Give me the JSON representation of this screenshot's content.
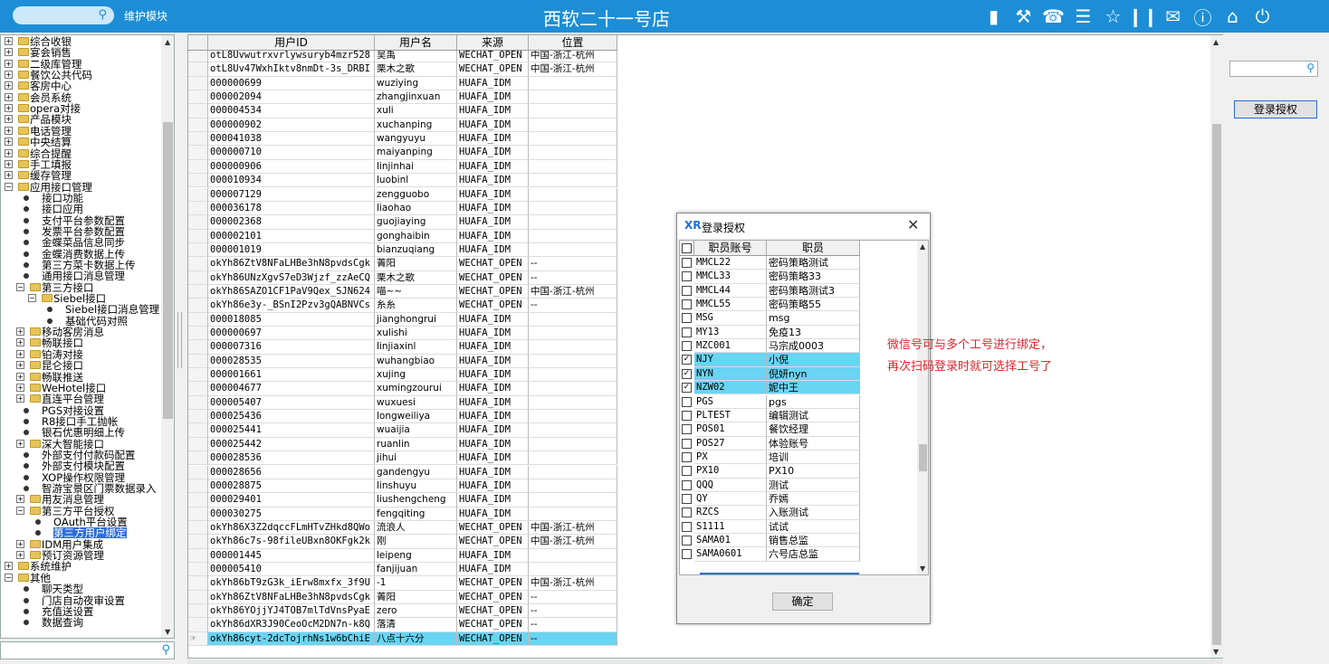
{
  "header": {
    "module_label": "维护模块",
    "title": "西软二十一号店",
    "icons": [
      "signal-icon",
      "tools-icon",
      "phone-icon",
      "menu-icon",
      "star-icon",
      "columns-icon",
      "mail-icon",
      "help-icon",
      "home-icon",
      "power-icon"
    ]
  },
  "tree": {
    "items": [
      {
        "label": "综合收银",
        "lvl": 0,
        "type": "folder"
      },
      {
        "label": "宴会销售",
        "lvl": 0,
        "type": "folder"
      },
      {
        "label": "二级库管理",
        "lvl": 0,
        "type": "folder"
      },
      {
        "label": "餐饮公共代码",
        "lvl": 0,
        "type": "folder"
      },
      {
        "label": "客房中心",
        "lvl": 0,
        "type": "folder"
      },
      {
        "label": "会员系统",
        "lvl": 0,
        "type": "folder"
      },
      {
        "label": "opera对接",
        "lvl": 0,
        "type": "folder"
      },
      {
        "label": "产品模块",
        "lvl": 0,
        "type": "folder"
      },
      {
        "label": "电话管理",
        "lvl": 0,
        "type": "folder"
      },
      {
        "label": "中央结算",
        "lvl": 0,
        "type": "folder"
      },
      {
        "label": "综合提醒",
        "lvl": 0,
        "type": "folder"
      },
      {
        "label": "手工填报",
        "lvl": 0,
        "type": "folder"
      },
      {
        "label": "缓存管理",
        "lvl": 0,
        "type": "folder"
      },
      {
        "label": "应用接口管理",
        "lvl": 0,
        "type": "folder",
        "open": true
      },
      {
        "label": "接口功能",
        "lvl": 1,
        "type": "leaf"
      },
      {
        "label": "接口应用",
        "lvl": 1,
        "type": "leaf"
      },
      {
        "label": "支付平台参数配置",
        "lvl": 1,
        "type": "leaf"
      },
      {
        "label": "发票平台参数配置",
        "lvl": 1,
        "type": "leaf"
      },
      {
        "label": "金蝶菜品信息同步",
        "lvl": 1,
        "type": "leaf"
      },
      {
        "label": "金蝶消费数据上传",
        "lvl": 1,
        "type": "leaf"
      },
      {
        "label": "第三方菜卡数据上传",
        "lvl": 1,
        "type": "leaf"
      },
      {
        "label": "通用接口消息管理",
        "lvl": 1,
        "type": "leaf"
      },
      {
        "label": "第三方接口",
        "lvl": 1,
        "type": "folder",
        "open": true
      },
      {
        "label": "Siebel接口",
        "lvl": 2,
        "type": "folder",
        "open": true
      },
      {
        "label": "Siebel接口消息管理",
        "lvl": 3,
        "type": "leaf"
      },
      {
        "label": "基础代码对照",
        "lvl": 3,
        "type": "leaf"
      },
      {
        "label": "移动客房消息",
        "lvl": 1,
        "type": "folder"
      },
      {
        "label": "畅联接口",
        "lvl": 1,
        "type": "folder"
      },
      {
        "label": "铂涛对接",
        "lvl": 1,
        "type": "folder"
      },
      {
        "label": "昆仑接口",
        "lvl": 1,
        "type": "folder"
      },
      {
        "label": "畅联推送",
        "lvl": 1,
        "type": "folder"
      },
      {
        "label": "WeHotel接口",
        "lvl": 1,
        "type": "folder"
      },
      {
        "label": "直连平台管理",
        "lvl": 1,
        "type": "folder"
      },
      {
        "label": "PGS对接设置",
        "lvl": 1,
        "type": "leaf"
      },
      {
        "label": "R8接口手工抛帐",
        "lvl": 1,
        "type": "leaf"
      },
      {
        "label": "银石优惠明细上传",
        "lvl": 1,
        "type": "leaf"
      },
      {
        "label": "深大智能接口",
        "lvl": 1,
        "type": "folder"
      },
      {
        "label": "外部支付付款码配置",
        "lvl": 1,
        "type": "leaf"
      },
      {
        "label": "外部支付模块配置",
        "lvl": 1,
        "type": "leaf"
      },
      {
        "label": "XOP操作权限管理",
        "lvl": 1,
        "type": "leaf"
      },
      {
        "label": "智游宝景区门票数据录入",
        "lvl": 1,
        "type": "leaf"
      },
      {
        "label": "用友消息管理",
        "lvl": 1,
        "type": "folder"
      },
      {
        "label": "第三方平台授权",
        "lvl": 1,
        "type": "folder",
        "open": true
      },
      {
        "label": "OAuth平台设置",
        "lvl": 2,
        "type": "leaf"
      },
      {
        "label": "第三方用户绑定",
        "lvl": 2,
        "type": "leaf",
        "selected": true
      },
      {
        "label": "IDM用户集成",
        "lvl": 1,
        "type": "folder"
      },
      {
        "label": "预订资源管理",
        "lvl": 1,
        "type": "folder"
      },
      {
        "label": "系统维护",
        "lvl": 0,
        "type": "folder"
      },
      {
        "label": "其他",
        "lvl": 0,
        "type": "folder",
        "open": true
      },
      {
        "label": "聊天类型",
        "lvl": 1,
        "type": "leaf"
      },
      {
        "label": "门店自动夜审设置",
        "lvl": 1,
        "type": "leaf"
      },
      {
        "label": "充值送设置",
        "lvl": 1,
        "type": "leaf"
      },
      {
        "label": "数据查询",
        "lvl": 1,
        "type": "leaf"
      }
    ]
  },
  "grid": {
    "columns": [
      "用户ID",
      "用户名",
      "来源",
      "位置"
    ],
    "rows": [
      [
        "otL8Uvwutrxvrlywsuryb4mzr528",
        "吴禹",
        "WECHAT_OPEN",
        "中国-浙江-杭州"
      ],
      [
        "otL8Uv47WxhIktv8nmDt-3s_DRBI",
        "栗木之歌",
        "WECHAT_OPEN",
        "中国-浙江-杭州"
      ],
      [
        "000000699",
        "wuziying",
        "HUAFA_IDM",
        ""
      ],
      [
        "000002094",
        "zhangjinxuan",
        "HUAFA_IDM",
        ""
      ],
      [
        "000004534",
        "xuli",
        "HUAFA_IDM",
        ""
      ],
      [
        "000000902",
        "xuchanping",
        "HUAFA_IDM",
        ""
      ],
      [
        "000041038",
        "wangyuyu",
        "HUAFA_IDM",
        ""
      ],
      [
        "000000710",
        "maiyanping",
        "HUAFA_IDM",
        ""
      ],
      [
        "000000906",
        "linjinhai",
        "HUAFA_IDM",
        ""
      ],
      [
        "000010934",
        "luobinl",
        "HUAFA_IDM",
        ""
      ],
      [
        "000007129",
        "zengguobo",
        "HUAFA_IDM",
        ""
      ],
      [
        "000036178",
        "liaohao",
        "HUAFA_IDM",
        ""
      ],
      [
        "000002368",
        "guojiaying",
        "HUAFA_IDM",
        ""
      ],
      [
        "000002101",
        "gonghaibin",
        "HUAFA_IDM",
        ""
      ],
      [
        "000001019",
        "bianzuqiang",
        "HUAFA_IDM",
        ""
      ],
      [
        "okYh86ZtV8NFaLHBe3hN8pvdsCgk",
        "菁阳",
        "WECHAT_OPEN",
        "--"
      ],
      [
        "okYh86UNzXgvS7eD3Wjzf_zzAeCQ",
        "栗木之歌",
        "WECHAT_OPEN",
        "--"
      ],
      [
        "okYh86SAZO1CF1PaV9Qex_SJN624",
        "喵~~",
        "WECHAT_OPEN",
        "中国-浙江-杭州"
      ],
      [
        "okYh86e3y-_BSnI2Pzv3gQABNVCs",
        "糸糸",
        "WECHAT_OPEN",
        "--"
      ],
      [
        "000018085",
        "jianghongrui",
        "HUAFA_IDM",
        ""
      ],
      [
        "000000697",
        "xulishi",
        "HUAFA_IDM",
        ""
      ],
      [
        "000007316",
        "linjiaxinl",
        "HUAFA_IDM",
        ""
      ],
      [
        "000028535",
        "wuhangbiao",
        "HUAFA_IDM",
        ""
      ],
      [
        "000001661",
        "xujing",
        "HUAFA_IDM",
        ""
      ],
      [
        "000004677",
        "xumingzourui",
        "HUAFA_IDM",
        ""
      ],
      [
        "000005407",
        "wuxuesi",
        "HUAFA_IDM",
        ""
      ],
      [
        "000025436",
        "longweiliya",
        "HUAFA_IDM",
        ""
      ],
      [
        "000025441",
        "wuaijia",
        "HUAFA_IDM",
        ""
      ],
      [
        "000025442",
        "ruanlin",
        "HUAFA_IDM",
        ""
      ],
      [
        "000028536",
        "jihui",
        "HUAFA_IDM",
        ""
      ],
      [
        "000028656",
        "gandengyu",
        "HUAFA_IDM",
        ""
      ],
      [
        "000028875",
        "linshuyu",
        "HUAFA_IDM",
        ""
      ],
      [
        "000029401",
        "liushengcheng",
        "HUAFA_IDM",
        ""
      ],
      [
        "000030275",
        "fengqiting",
        "HUAFA_IDM",
        ""
      ],
      [
        "okYh86X3Z2dqccFLmHTvZHkd8QWo",
        "流浪人",
        "WECHAT_OPEN",
        "中国-浙江-杭州"
      ],
      [
        "okYh86c7s-98filеUBxn8OKFgk2k",
        "刚",
        "WECHAT_OPEN",
        "中国-浙江-杭州"
      ],
      [
        "000001445",
        "leipeng",
        "HUAFA_IDM",
        ""
      ],
      [
        "000005410",
        "fanjijuan",
        "HUAFA_IDM",
        ""
      ],
      [
        "okYh86bT9zG3k_iErw8mxfx_3f9U",
        "-1",
        "WECHAT_OPEN",
        "中国-浙江-杭州"
      ],
      [
        "okYh86ZtV8NFaLHBe3hN8pvdsCgk",
        "菁阳",
        "WECHAT_OPEN",
        "--"
      ],
      [
        "okYh86YOjjYJ4TOB7mlTdVnsPyaE",
        "zero",
        "WECHAT_OPEN",
        "--"
      ],
      [
        "okYh86dXR3J90CeoOcM2DN7n-k8Q",
        "  落清",
        "WECHAT_OPEN",
        "--"
      ],
      [
        "okYh86cyt-2dcTojrhNs1w6bChiE",
        "八点十六分",
        "WECHAT_OPEN",
        "--"
      ]
    ]
  },
  "right": {
    "login_button": "登录授权"
  },
  "dialog": {
    "logo": "XR",
    "title": "登录授权",
    "columns": [
      "职员账号",
      "职员"
    ],
    "rows": [
      {
        "code": "MMCL22",
        "name": "密码策略测试",
        "checked": false
      },
      {
        "code": "MMCL33",
        "name": "密码策略33",
        "checked": false
      },
      {
        "code": "MMCL44",
        "name": "密码策略测试3",
        "checked": false
      },
      {
        "code": "MMCL55",
        "name": "密码策略55",
        "checked": false
      },
      {
        "code": "MSG",
        "name": "msg",
        "checked": false
      },
      {
        "code": "MY13",
        "name": "免疫13",
        "checked": false
      },
      {
        "code": "MZC001",
        "name": "马宗成0003",
        "checked": false
      },
      {
        "code": "NJY",
        "name": "小倪",
        "checked": true
      },
      {
        "code": "NYN",
        "name": "倪妍nyn",
        "checked": true
      },
      {
        "code": "NZW02",
        "name": "妮中王",
        "checked": true
      },
      {
        "code": "PGS",
        "name": "pgs",
        "checked": false
      },
      {
        "code": "PLTEST",
        "name": "编辑测试",
        "checked": false
      },
      {
        "code": "POS01",
        "name": "餐饮经理",
        "checked": false
      },
      {
        "code": "POS27",
        "name": "体验账号",
        "checked": false
      },
      {
        "code": "PX",
        "name": "培训",
        "checked": false
      },
      {
        "code": "PX10",
        "name": "PX10",
        "checked": false
      },
      {
        "code": "QQQ",
        "name": "测试",
        "checked": false
      },
      {
        "code": "QY",
        "name": "乔嫣",
        "checked": false
      },
      {
        "code": "RZCS",
        "name": "入账测试",
        "checked": false
      },
      {
        "code": "S1111",
        "name": "试试",
        "checked": false
      },
      {
        "code": "SAMA01",
        "name": "销售总监",
        "checked": false
      },
      {
        "code": "SAMA0601",
        "name": "六号店总监",
        "checked": false
      }
    ],
    "ok_button": "确定"
  },
  "note": {
    "line1": "微信号可与多个工号进行绑定，",
    "line2": "再次扫码登录时就可选择工号了"
  },
  "colors": {
    "header": "#1d8ed6",
    "highlight": "#6ad4f3",
    "note": "#e0252c",
    "selection": "#2f6fd6"
  }
}
